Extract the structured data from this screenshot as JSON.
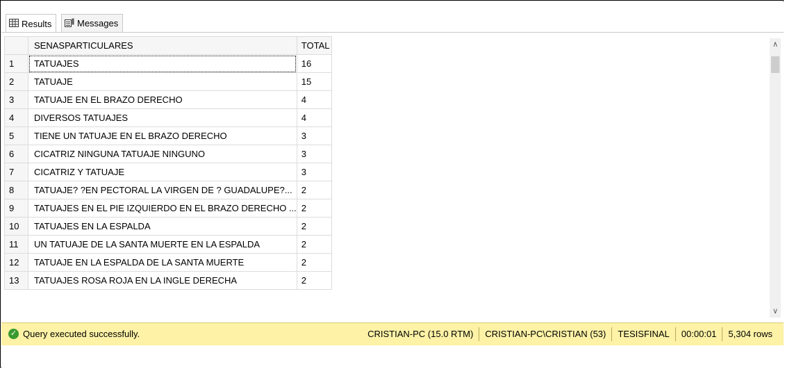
{
  "tabs": {
    "results_label": "Results",
    "messages_label": "Messages"
  },
  "grid": {
    "columns": [
      "SENASPARTICULARES",
      "TOTAL"
    ],
    "rows": [
      {
        "n": "1",
        "name": "TATUAJES",
        "total": "16"
      },
      {
        "n": "2",
        "name": "TATUAJE",
        "total": "15"
      },
      {
        "n": "3",
        "name": "TATUAJE EN EL BRAZO DERECHO",
        "total": "4"
      },
      {
        "n": "4",
        "name": "DIVERSOS TATUAJES",
        "total": "4"
      },
      {
        "n": "5",
        "name": "TIENE UN TATUAJE EN EL BRAZO DERECHO",
        "total": "3"
      },
      {
        "n": "6",
        "name": "CICATRIZ NINGUNA TATUAJE NINGUNO",
        "total": "3"
      },
      {
        "n": "7",
        "name": "CICATRIZ Y TATUAJE",
        "total": "3"
      },
      {
        "n": "8",
        "name": "TATUAJE? ?EN PECTORAL LA VIRGEN DE ?  GUADALUPE?...",
        "total": "2"
      },
      {
        "n": "9",
        "name": "TATUAJES EN EL PIE IZQUIERDO EN EL BRAZO DERECHO ...",
        "total": "2"
      },
      {
        "n": "10",
        "name": "TATUAJES EN LA ESPALDA",
        "total": "2"
      },
      {
        "n": "11",
        "name": "UN TATUAJE DE LA SANTA MUERTE EN LA ESPALDA",
        "total": "2"
      },
      {
        "n": "12",
        "name": "TATUAJE EN LA ESPALDA DE LA SANTA MUERTE",
        "total": "2"
      },
      {
        "n": "13",
        "name": "TATUAJES ROSA ROJA EN LA INGLE DERECHA",
        "total": "2"
      }
    ]
  },
  "status": {
    "message": "Query executed successfully.",
    "server": "CRISTIAN-PC (15.0 RTM)",
    "user": "CRISTIAN-PC\\CRISTIAN (53)",
    "database": "TESISFINAL",
    "elapsed": "00:00:01",
    "rows": "5,304 rows",
    "color": "#fdf2a6"
  },
  "icons": {
    "results": "grid-icon",
    "messages": "messages-icon",
    "status": "check-circle-icon",
    "scroll_up": "chevron-up-icon",
    "scroll_down": "chevron-down-icon"
  }
}
